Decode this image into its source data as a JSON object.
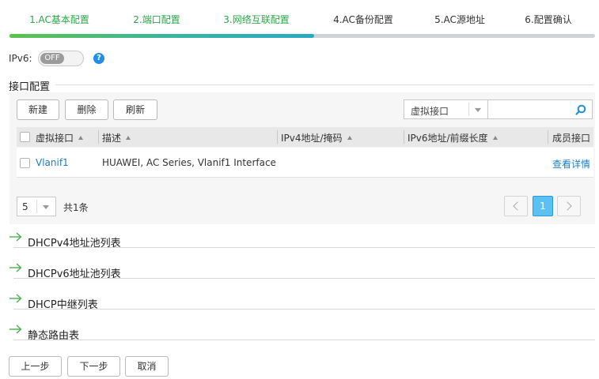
{
  "wizard": {
    "steps": [
      {
        "label": "1.AC基本配置",
        "state": "done"
      },
      {
        "label": "2.端口配置",
        "state": "done"
      },
      {
        "label": "3.网络互联配置",
        "state": "done"
      },
      {
        "label": "4.AC备份配置",
        "state": "todo"
      },
      {
        "label": "5.AC源地址",
        "state": "todo"
      },
      {
        "label": "6.配置确认",
        "state": "todo"
      }
    ],
    "progress": 0.52
  },
  "ipv6": {
    "label": "IPv6:",
    "toggle_text": "OFF",
    "help": "?"
  },
  "interface_section": {
    "title": "接口配置"
  },
  "toolbar": {
    "new_label": "新建",
    "delete_label": "删除",
    "refresh_label": "刷新"
  },
  "filter": {
    "select_value": "虚拟接口",
    "search_value": ""
  },
  "table": {
    "columns": [
      "虚拟接口",
      "描述",
      "IPv4地址/掩码",
      "IPv6地址/前缀长度",
      "成员接口"
    ],
    "rows": [
      {
        "name": "Vlanif1",
        "desc": "HUAWEI, AC Series, Vlanif1 Interface",
        "ipv4": "",
        "ipv6": "",
        "member": "查看详情"
      }
    ]
  },
  "pagination": {
    "page_size": "5",
    "total": "共1条",
    "current_page": "1"
  },
  "sections": [
    "DHCPv4地址池列表",
    "DHCPv6地址池列表",
    "DHCP中继列表",
    "静态路由表"
  ],
  "footer": {
    "prev_label": "上一步",
    "next_label": "下一步",
    "cancel_label": "取消"
  },
  "colors": {
    "accent_green": "#2aa846",
    "accent_blue": "#1a7fc4",
    "page_active": "#5bc0f2",
    "help_blue": "#1e90e8"
  },
  "icons": {
    "help": "question-circle-icon",
    "search": "search-icon",
    "expand": "arrow-right-icon",
    "dropdown": "caret-down-icon",
    "sort": "sort-asc-icon"
  }
}
